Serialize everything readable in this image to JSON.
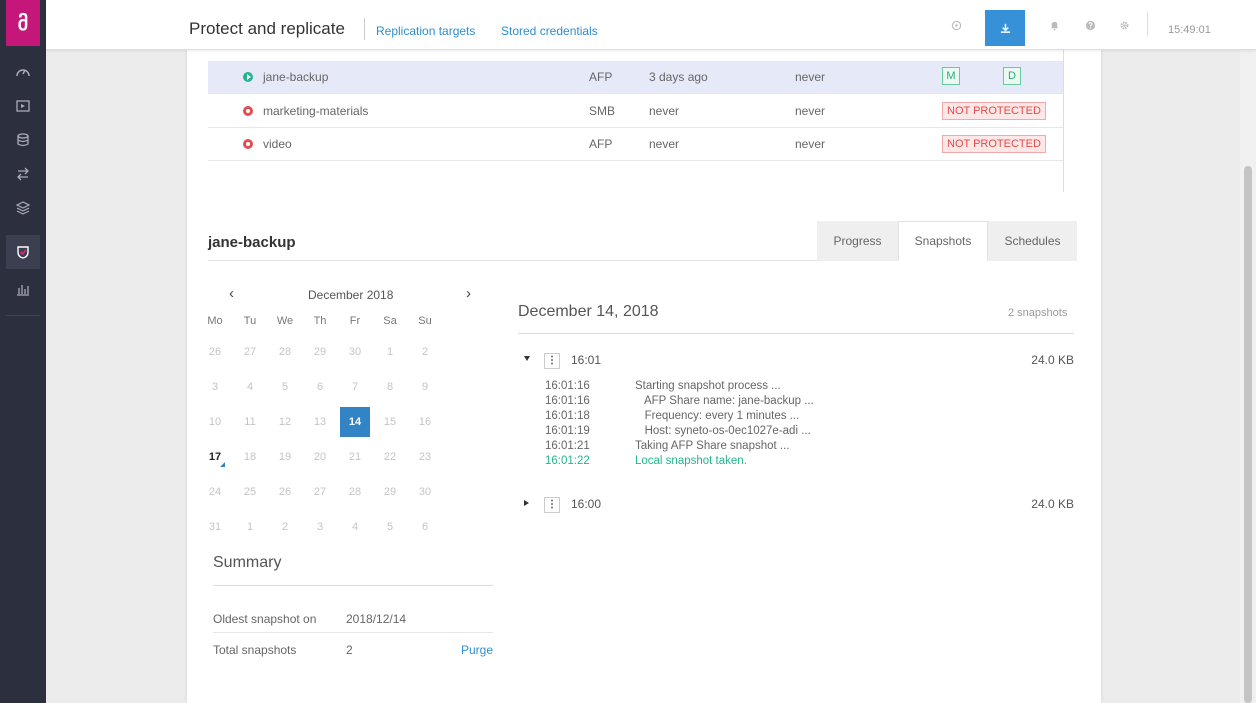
{
  "header": {
    "title": "Protect and replicate",
    "links": [
      "Replication targets",
      "Stored credentials"
    ],
    "clock": "15:49:01",
    "icons": [
      "circle-icon",
      "download-icon",
      "bell-icon",
      "help-icon",
      "gear-icon"
    ]
  },
  "sidebar": {
    "logo": "მ",
    "items": [
      "dashboard-icon",
      "media-icon",
      "storage-icon",
      "transfer-icon",
      "layers-icon",
      "protect-icon",
      "stats-icon"
    ],
    "active_index": 5
  },
  "shares": [
    {
      "name": "jane-backup",
      "protocol": "AFP",
      "last_snapshot": "3 days ago",
      "last_replication": "never",
      "status": "protected",
      "badges": [
        "M",
        "D"
      ],
      "selected": true
    },
    {
      "name": "marketing-materials",
      "protocol": "SMB",
      "last_snapshot": "never",
      "last_replication": "never",
      "status": "NOT PROTECTED"
    },
    {
      "name": "video",
      "protocol": "AFP",
      "last_snapshot": "never",
      "last_replication": "never",
      "status": "NOT PROTECTED"
    }
  ],
  "detail": {
    "title": "jane-backup",
    "tabs": [
      "Progress",
      "Snapshots",
      "Schedules"
    ],
    "active_tab": "Snapshots"
  },
  "calendar": {
    "month": "December 2018",
    "prev": "‹",
    "next": "›",
    "weekdays": [
      "Mo",
      "Tu",
      "We",
      "Th",
      "Fr",
      "Sa",
      "Su"
    ],
    "weeks": [
      [
        "26",
        "27",
        "28",
        "29",
        "30",
        "1",
        "2"
      ],
      [
        "3",
        "4",
        "5",
        "6",
        "7",
        "8",
        "9"
      ],
      [
        "10",
        "11",
        "12",
        "13",
        "14",
        "15",
        "16"
      ],
      [
        "17",
        "18",
        "19",
        "20",
        "21",
        "22",
        "23"
      ],
      [
        "24",
        "25",
        "26",
        "27",
        "28",
        "29",
        "30"
      ],
      [
        "31",
        "1",
        "2",
        "3",
        "4",
        "5",
        "6"
      ]
    ],
    "snapshot_day": "14",
    "today": "17"
  },
  "summary": {
    "title": "Summary",
    "oldest_label": "Oldest snapshot on",
    "oldest_value": "2018/12/14",
    "total_label": "Total snapshots",
    "total_value": "2",
    "purge_label": "Purge"
  },
  "snapshots": {
    "date": "December 14, 2018",
    "count": "2 snapshots",
    "menu_glyph": "⋮",
    "entries": [
      {
        "time": "16:01",
        "size": "24.0 KB",
        "expanded": true,
        "log": [
          {
            "t": "16:01:16",
            "m": "Starting  snapshot process ..."
          },
          {
            "t": "16:01:16",
            "m": "   AFP Share name: jane-backup ..."
          },
          {
            "t": "16:01:18",
            "m": "   Frequency: every 1 minutes ..."
          },
          {
            "t": "16:01:19",
            "m": "   Host: syneto-os-0ec1027e-adi ..."
          },
          {
            "t": "16:01:21",
            "m": "Taking  AFP Share snapshot ..."
          },
          {
            "t": "16:01:22",
            "m": "Local  snapshot taken.",
            "ok": true
          }
        ]
      },
      {
        "time": "16:00",
        "size": "24.0 KB",
        "expanded": false
      }
    ]
  }
}
